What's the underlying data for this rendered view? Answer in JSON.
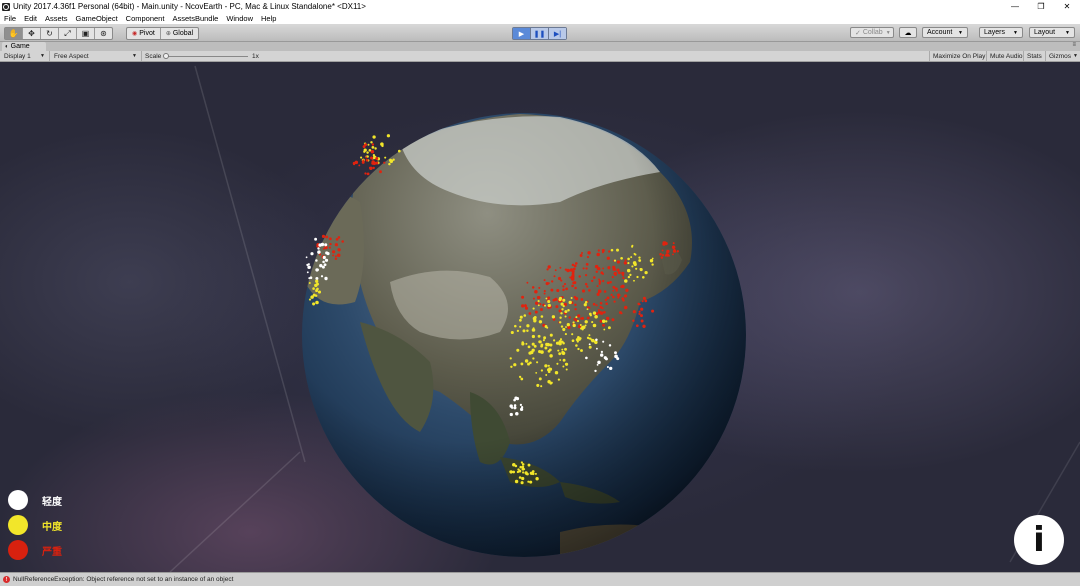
{
  "window": {
    "title": "Unity 2017.4.36f1 Personal (64bit) - Main.unity - NcovEarth - PC, Mac & Linux Standalone* <DX11>",
    "minimize": "—",
    "maximize": "❐",
    "close": "✕"
  },
  "menu": [
    "File",
    "Edit",
    "Assets",
    "GameObject",
    "Component",
    "AssetsBundle",
    "Window",
    "Help"
  ],
  "toolbar": {
    "tools": [
      {
        "name": "hand-tool",
        "glyph": "✋",
        "active": true
      },
      {
        "name": "move-tool",
        "glyph": "✥"
      },
      {
        "name": "rotate-tool",
        "glyph": "↻"
      },
      {
        "name": "scale-tool",
        "glyph": "⤢"
      },
      {
        "name": "rect-tool",
        "glyph": "▣"
      },
      {
        "name": "transform-tool",
        "glyph": "⊛"
      }
    ],
    "pivot": "Pivot",
    "global": "Global",
    "play": "▶",
    "pause": "❚❚",
    "step": "▶|",
    "collab": "Collab",
    "cloud": "☁",
    "account": "Account",
    "layers": "Layers",
    "layout": "Layout"
  },
  "game_tab": {
    "label": "Game",
    "menu": "≡",
    "display": "Display 1",
    "aspect": "Free Aspect",
    "scale_label": "Scale",
    "scale_value": "1x",
    "maximize_on_play": "Maximize On Play",
    "mute_audio": "Mute Audio",
    "stats": "Stats",
    "gizmos": "Gizmos"
  },
  "legend": [
    {
      "label": "轻度",
      "color": "#ffffff",
      "text_color": "#ffffff"
    },
    {
      "label": "中度",
      "color": "#f2e62a",
      "text_color": "#f2e62a"
    },
    {
      "label": "严重",
      "color": "#d8210f",
      "text_color": "#d8210f"
    }
  ],
  "info_button": "i",
  "status": {
    "icon": "!",
    "message": "NullReferenceException: Object reference not set to an instance of an object"
  },
  "colors": {
    "mild": "#ffffff",
    "moderate": "#f2e62a",
    "severe": "#e0230f"
  }
}
